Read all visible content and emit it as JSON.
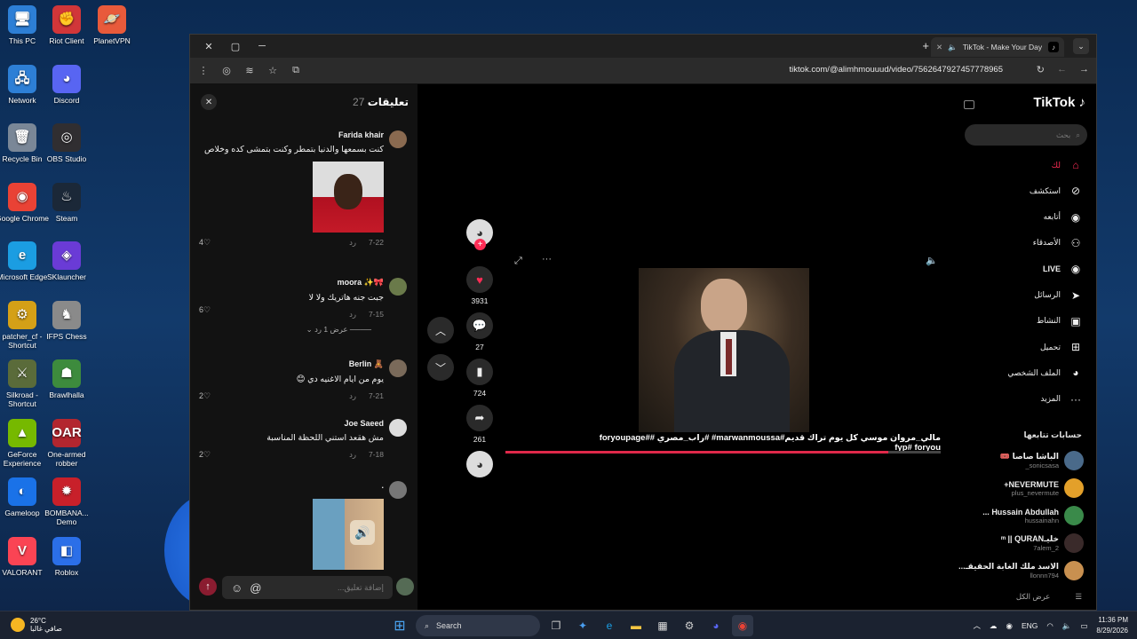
{
  "desktop": {
    "col1": [
      {
        "label": "This PC",
        "icon": "monitor-icon",
        "color": "#2d7fd6",
        "glyph": "🖥"
      },
      {
        "label": "Network",
        "icon": "network-icon",
        "color": "#2d7fd6",
        "glyph": "🖧"
      },
      {
        "label": "Recycle Bin",
        "icon": "recycle-bin-icon",
        "color": "#7a8797",
        "glyph": "🗑"
      },
      {
        "label": "Google Chrome",
        "icon": "chrome-icon",
        "color": "#e94235",
        "glyph": "◉"
      },
      {
        "label": "Microsoft Edge",
        "icon": "edge-icon",
        "color": "#1b9de2",
        "glyph": "e"
      },
      {
        "label": "patcher_cf - Shortcut",
        "icon": "patcher-icon",
        "color": "#d4a017",
        "glyph": "⚙"
      },
      {
        "label": "Silkroad - Shortcut",
        "icon": "silkroad-icon",
        "color": "#5a6b3a",
        "glyph": "⚔"
      },
      {
        "label": "GeForce Experience",
        "icon": "geforce-icon",
        "color": "#76b900",
        "glyph": "▲"
      },
      {
        "label": "Gameloop",
        "icon": "gameloop-icon",
        "color": "#1a72e8",
        "glyph": "◐"
      },
      {
        "label": "VALORANT",
        "icon": "valorant-icon",
        "color": "#fa4454",
        "glyph": "V"
      }
    ],
    "col2": [
      {
        "label": "Riot Client",
        "icon": "riot-client-icon",
        "color": "#d13639",
        "glyph": "✊"
      },
      {
        "label": "Discord",
        "icon": "discord-icon",
        "color": "#5865f2",
        "glyph": "◕"
      },
      {
        "label": "OBS Studio",
        "icon": "obs-icon",
        "color": "#302e31",
        "glyph": "◎"
      },
      {
        "label": "Steam",
        "icon": "steam-icon",
        "color": "#1b2838",
        "glyph": "♨"
      },
      {
        "label": "SKlauncher",
        "icon": "sklauncher-icon",
        "color": "#6a3bd6",
        "glyph": "◈"
      },
      {
        "label": "IFPS Chess",
        "icon": "chess-icon",
        "color": "#8a8a8a",
        "glyph": "♞"
      },
      {
        "label": "Brawlhalla",
        "icon": "brawlhalla-icon",
        "color": "#3d8b3d",
        "glyph": "☗"
      },
      {
        "label": "One-armed robber",
        "icon": "slot-machine-icon",
        "color": "#b3262f",
        "glyph": "OAR"
      },
      {
        "label": "BOMBANA... Demo",
        "icon": "bombana-icon",
        "color": "#c8202a",
        "glyph": "✹"
      },
      {
        "label": "Roblox",
        "icon": "roblox-icon",
        "color": "#2b6fe8",
        "glyph": "◧"
      }
    ],
    "col2_top": {
      "label": "PlanetVPN",
      "icon": "planetvpn-icon",
      "color": "#e85a3b",
      "glyph": "🪐"
    }
  },
  "browser": {
    "tab_title": "TikTok - Make Your Day",
    "url": "tiktok.com/@alimhmouuud/video/7562647927457778965"
  },
  "comments": {
    "title": "تعليقات",
    "count": "27",
    "items": [
      {
        "user": "Farida khair",
        "text": "كنت بسمعها والدنيا بتمطر وكنت بتمشى كده وخلاص",
        "date": "7-22",
        "reply": "رد",
        "likes": "4",
        "avatar": "#8a6a50",
        "has_image": true
      },
      {
        "user": "🎀✨ moora",
        "text": "جبت جنه هاتريك ولا لا",
        "date": "7-15",
        "reply": "رد",
        "likes": "6",
        "avatar": "#6a7a4a",
        "replies_label": "عرض 1 رد"
      },
      {
        "user": "🧸 Berlin",
        "text": "يوم من ايام الاغنيه دي 😊",
        "date": "7-21",
        "reply": "رد",
        "likes": "2",
        "avatar": "#7a6a5a"
      },
      {
        "user": "Joe Saeed",
        "text": "مش هقعد استني اللحظة المناسبة",
        "date": "7-18",
        "reply": "رد",
        "likes": "2",
        "avatar": "#dddddd"
      },
      {
        "user": ".",
        "text": "",
        "avatar": "#777777",
        "has_image2": true
      }
    ],
    "input_placeholder": "إضافة تعليق..."
  },
  "video": {
    "likes": "3931",
    "comments": "27",
    "saves": "724",
    "shares": "261",
    "caption": "مالي_مروان موسي كل يوم تراك قديم#marwanmoussa# #راب_مصري #foryoupage# fyp# foryou",
    "progress": 0.88
  },
  "tiktok_nav": {
    "logo": "TikTok",
    "search_placeholder": "بحث",
    "items": [
      {
        "label": "لك",
        "icon": "home-icon",
        "color": "#fe2c55"
      },
      {
        "label": "استكشف",
        "icon": "compass-icon"
      },
      {
        "label": "أتابعه",
        "icon": "following-icon"
      },
      {
        "label": "الأصدقاء",
        "icon": "friends-icon"
      },
      {
        "label": "LIVE",
        "icon": "live-icon"
      },
      {
        "label": "الرسائل",
        "icon": "send-icon"
      },
      {
        "label": "النشاط",
        "icon": "activity-icon"
      },
      {
        "label": "تحميل",
        "icon": "upload-icon"
      },
      {
        "label": "الملف الشخصي",
        "icon": "profile-icon"
      },
      {
        "label": "المزيد",
        "icon": "more-icon"
      }
    ],
    "following_title": "حسابات تتابعها",
    "following": [
      {
        "name": "الباشا صاصا 🎟️",
        "handle": "sonicsasa_",
        "avatar": "#4a6a8a"
      },
      {
        "name": "NEVERMUTE+",
        "handle": "plus_nevermute",
        "avatar": "#e3a02a"
      },
      {
        "name": "Hussain Abdullah ...",
        "handle": "hussainahn",
        "avatar": "#3a8a4a"
      },
      {
        "name": "خليـᵐ || QURAN",
        "handle": "7alem_2",
        "avatar": "#3a2a2a"
      },
      {
        "name": "الاسد ملك الغابة الحقيقـ...",
        "handle": "llonnn794",
        "avatar": "#c89050"
      }
    ],
    "see_all": "عرض الكل"
  },
  "taskbar": {
    "temp": "26°C",
    "weather": "صافي غالبا",
    "search": "Search",
    "lang": "ENG",
    "time": "11:36 PM",
    "date": "8/29/2026"
  }
}
